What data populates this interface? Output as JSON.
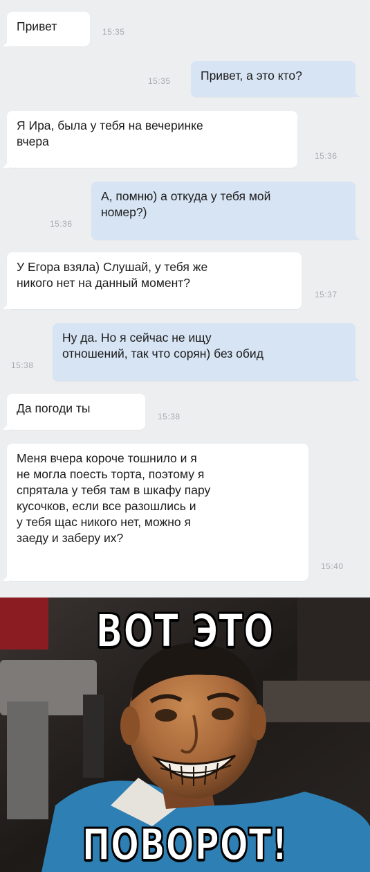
{
  "messages": [
    {
      "side": "in",
      "text": "Привет",
      "time": "15:35"
    },
    {
      "side": "out",
      "text": "Привет, а это кто?",
      "time": "15:35"
    },
    {
      "side": "in",
      "text": "Я Ира, была у тебя на вечеринке\nвчера",
      "time": "15:36"
    },
    {
      "side": "out",
      "text": "А, помню) а откуда у тебя мой\nномер?)",
      "time": "15:36"
    },
    {
      "side": "in",
      "text": "У Егора взяла) Слушай, у тебя же\nникого нет на данный момент?",
      "time": "15:37"
    },
    {
      "side": "out",
      "text": "Ну да. Но я сейчас не ищу\nотношений, так что сорян) без обид",
      "time": "15:38"
    },
    {
      "side": "in",
      "text": "Да погоди ты",
      "time": "15:38"
    },
    {
      "side": "in",
      "text": "Меня вчера короче тошнило и я\nне могла поесть торта, поэтому я\nспрятала у тебя там в шкафу пару\nкусочков, если все разошлись и\nу тебя щас никого нет, можно я\nзаеду и заберу их?",
      "time": "15:40"
    }
  ],
  "meme": {
    "top_caption": "ВОТ ЭТО",
    "bottom_caption": "ПОВОРОТ!"
  },
  "colors": {
    "chat_background": "#edeef0",
    "incoming_bubble": "#ffffff",
    "outgoing_bubble": "#d7e4f4",
    "timestamp": "#a6abb1"
  }
}
